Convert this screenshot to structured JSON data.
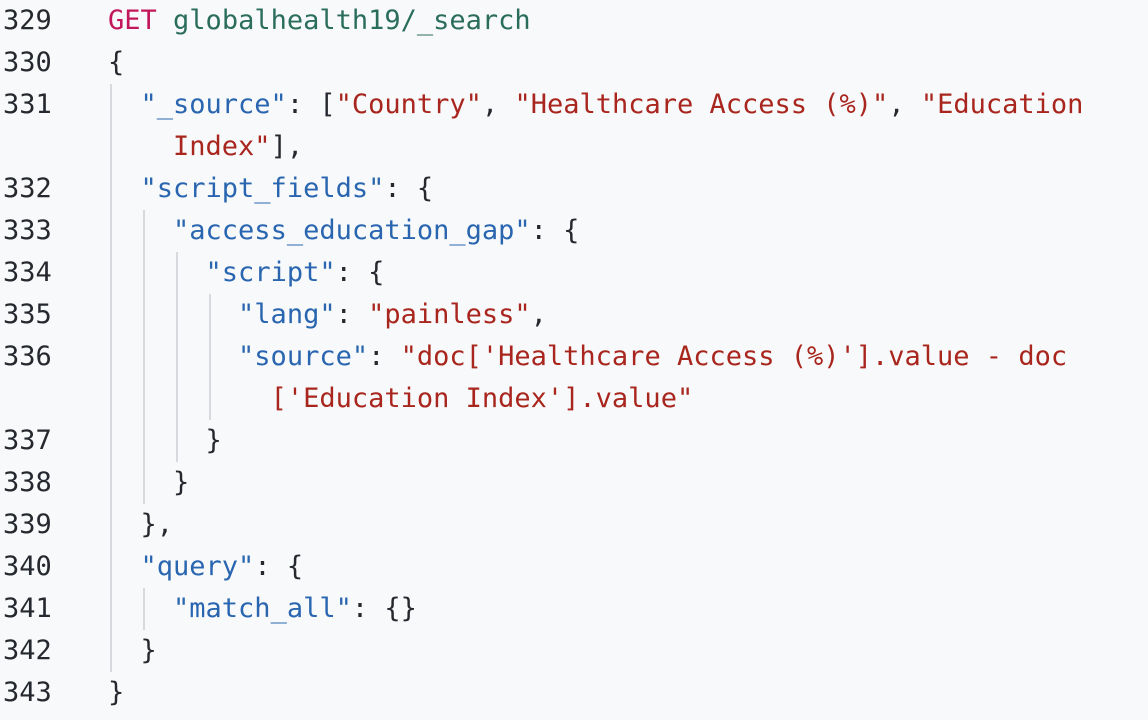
{
  "editor": {
    "lines": [
      {
        "num": "329",
        "tokens": [
          {
            "t": "method",
            "v": "GET"
          },
          {
            "t": "punc",
            "v": " "
          },
          {
            "t": "path",
            "v": "globalhealth19/_search"
          }
        ]
      },
      {
        "num": "330",
        "tokens": [
          {
            "t": "punc",
            "v": "{"
          }
        ]
      },
      {
        "num": "331",
        "tokens": [
          {
            "t": "punc",
            "v": "  "
          },
          {
            "t": "key",
            "v": "\"_source\""
          },
          {
            "t": "punc",
            "v": ": ["
          },
          {
            "t": "str",
            "v": "\"Country\""
          },
          {
            "t": "punc",
            "v": ", "
          },
          {
            "t": "str",
            "v": "\"Healthcare Access (%)\""
          },
          {
            "t": "punc",
            "v": ", "
          },
          {
            "t": "str",
            "v": "\"Education"
          }
        ]
      },
      {
        "num": "",
        "tokens": [
          {
            "t": "punc",
            "v": "    "
          },
          {
            "t": "str",
            "v": "Index\""
          },
          {
            "t": "punc",
            "v": "],"
          }
        ]
      },
      {
        "num": "332",
        "tokens": [
          {
            "t": "punc",
            "v": "  "
          },
          {
            "t": "key",
            "v": "\"script_fields\""
          },
          {
            "t": "punc",
            "v": ": {"
          }
        ]
      },
      {
        "num": "333",
        "tokens": [
          {
            "t": "punc",
            "v": "    "
          },
          {
            "t": "key",
            "v": "\"access_education_gap\""
          },
          {
            "t": "punc",
            "v": ": {"
          }
        ]
      },
      {
        "num": "334",
        "tokens": [
          {
            "t": "punc",
            "v": "      "
          },
          {
            "t": "key",
            "v": "\"script\""
          },
          {
            "t": "punc",
            "v": ": {"
          }
        ]
      },
      {
        "num": "335",
        "tokens": [
          {
            "t": "punc",
            "v": "        "
          },
          {
            "t": "key",
            "v": "\"lang\""
          },
          {
            "t": "punc",
            "v": ": "
          },
          {
            "t": "str",
            "v": "\"painless\""
          },
          {
            "t": "punc",
            "v": ","
          }
        ]
      },
      {
        "num": "336",
        "tokens": [
          {
            "t": "punc",
            "v": "        "
          },
          {
            "t": "key",
            "v": "\"source\""
          },
          {
            "t": "punc",
            "v": ": "
          },
          {
            "t": "str",
            "v": "\"doc['Healthcare Access (%)'].value - doc"
          }
        ]
      },
      {
        "num": "",
        "tokens": [
          {
            "t": "punc",
            "v": "          "
          },
          {
            "t": "str",
            "v": "['Education Index'].value\""
          }
        ]
      },
      {
        "num": "337",
        "tokens": [
          {
            "t": "punc",
            "v": "      }"
          }
        ]
      },
      {
        "num": "338",
        "tokens": [
          {
            "t": "punc",
            "v": "    }"
          }
        ]
      },
      {
        "num": "339",
        "tokens": [
          {
            "t": "punc",
            "v": "  },"
          }
        ]
      },
      {
        "num": "340",
        "tokens": [
          {
            "t": "punc",
            "v": "  "
          },
          {
            "t": "key",
            "v": "\"query\""
          },
          {
            "t": "punc",
            "v": ": {"
          }
        ]
      },
      {
        "num": "341",
        "tokens": [
          {
            "t": "punc",
            "v": "    "
          },
          {
            "t": "key",
            "v": "\"match_all\""
          },
          {
            "t": "punc",
            "v": ": {}"
          }
        ]
      },
      {
        "num": "342",
        "tokens": [
          {
            "t": "punc",
            "v": "  }"
          }
        ]
      },
      {
        "num": "343",
        "tokens": [
          {
            "t": "punc",
            "v": "}"
          }
        ]
      }
    ]
  },
  "colors": {
    "background": "#f8f9fb",
    "method": "#c2185b",
    "path": "#2b6d5b",
    "key": "#2a66b0",
    "string": "#a8261d",
    "punctuation": "#25282e",
    "indent_guide": "#d6d9de"
  }
}
